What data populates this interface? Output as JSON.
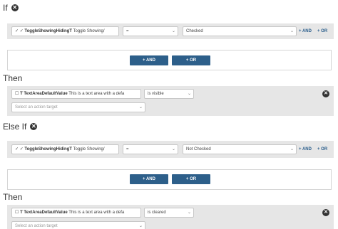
{
  "sections": {
    "if": {
      "title": "If"
    },
    "then1": {
      "title": "Then"
    },
    "elseif": {
      "title": "Else If"
    },
    "then2": {
      "title": "Then"
    }
  },
  "conditions": [
    {
      "check_icon": "✓",
      "field_name": "ToggleShowingHidingT",
      "field_desc": "Toggle Showing/",
      "operator": "=",
      "value": "Checked",
      "and_label": "+ AND",
      "or_label": "+ OR"
    },
    {
      "check_icon": "✓",
      "field_name": "ToggleShowingHidingT",
      "field_desc": "Toggle Showing/",
      "operator": "=",
      "value": "Not Checked",
      "and_label": "+ AND",
      "or_label": "+ OR"
    }
  ],
  "group_buttons": {
    "and_label": "+ AND",
    "or_label": "+ OR"
  },
  "actions": [
    {
      "field_name": "TextAreaDefaultValue",
      "field_desc": "This is a text area with a defa",
      "action": "is visible",
      "target_placeholder": "Select an action target"
    },
    {
      "field_name": "TextAreaDefaultValue",
      "field_desc": "This is a text area with a defa",
      "action": "is cleared",
      "target_placeholder": "Select an action target"
    }
  ],
  "colors": {
    "accent": "#2d5f8a",
    "panel": "#e6e6e6",
    "link": "#2a5e8c"
  }
}
